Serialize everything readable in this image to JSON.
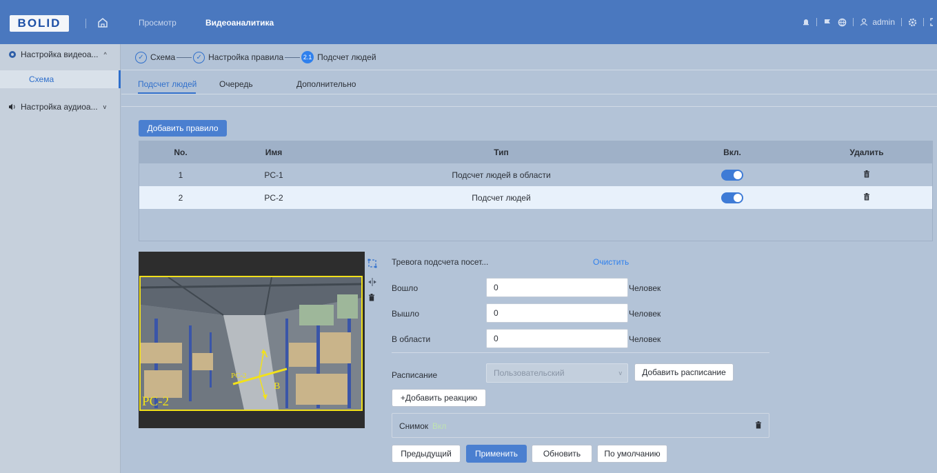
{
  "header": {
    "logo_text": "BOLID",
    "nav": [
      "Просмотр",
      "Видеоаналитика"
    ],
    "user": "admin"
  },
  "sidebar": {
    "groups": [
      {
        "label": "Настройка видеоа...",
        "expanded": true,
        "items": [
          {
            "label": "Схема",
            "selected": true
          }
        ]
      },
      {
        "label": "Настройка аудиоа...",
        "expanded": false
      }
    ]
  },
  "steps": [
    {
      "label": "Схема",
      "state": "done"
    },
    {
      "label": "Настройка правила",
      "state": "done"
    },
    {
      "label": "Подсчет людей",
      "state": "current",
      "badge": "2.1"
    }
  ],
  "tabs": [
    "Подсчет людей",
    "Очередь",
    "Дополнительно"
  ],
  "active_tab": "Подсчет людей",
  "add_rule_button": "Добавить правило",
  "table": {
    "columns": [
      "No.",
      "Имя",
      "Тип",
      "Вкл.",
      "Удалить"
    ],
    "rows": [
      {
        "no": "1",
        "name": "PC-1",
        "type": "Подсчет людей в области",
        "enabled": true
      },
      {
        "no": "2",
        "name": "PC-2",
        "type": "Подсчет людей",
        "enabled": true
      }
    ],
    "selected_row": "2"
  },
  "video": {
    "zone_label": "PC-2",
    "line_label": "PC-2",
    "direction_a": "A",
    "direction_b": "B"
  },
  "form": {
    "alarm_label": "Тревога подсчета посет...",
    "clear_link": "Очистить",
    "entered_label": "Вошло",
    "entered_value": "0",
    "exited_label": "Вышло",
    "exited_value": "0",
    "in_area_label": "В области",
    "in_area_value": "0",
    "unit": "Человек",
    "schedule_label": "Расписание",
    "schedule_value": "Пользовательский",
    "add_schedule_button": "Добавить расписание",
    "add_reaction_button": "+Добавить реакцию",
    "snapshot_label": "Снимок",
    "snapshot_status": "Вкл"
  },
  "footer_buttons": {
    "previous": "Предыдущий",
    "apply": "Применить",
    "refresh": "Обновить",
    "default": "По умолчанию"
  },
  "colors": {
    "topbar": "#4a78bf",
    "accent": "#2f6fcb",
    "zone": "#f2e11a",
    "background": "#b3c3d7"
  }
}
